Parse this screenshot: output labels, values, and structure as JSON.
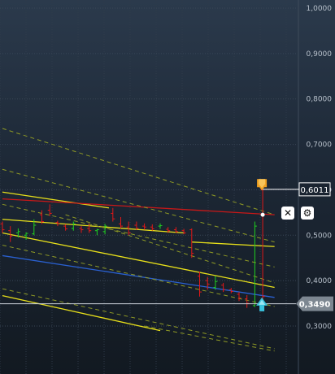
{
  "chart_data": {
    "type": "candlestick",
    "y_axis": {
      "ticks": [
        "1,0000",
        "0,9000",
        "0,8000",
        "0,7000",
        "0,6000",
        "0,5000",
        "0,4000",
        "0,3000"
      ],
      "ylim": [
        0.24,
        1.01
      ]
    },
    "price_tags": {
      "upper": "0,6011",
      "lower": "0,3490"
    },
    "colors": {
      "up": "#1fd01f",
      "down": "#e01818",
      "neutral": "#e6e62a",
      "solid_yellow": "#e8e01a",
      "dashed_yellow": "#8f9a25",
      "red_line": "#c81818",
      "blue_line": "#2a60d0",
      "arrow_orange": "#f0a020",
      "arrow_cyan": "#39c3de"
    },
    "candles": [
      {
        "o": 0.525,
        "h": 0.53,
        "l": 0.505,
        "c": 0.512
      },
      {
        "o": 0.51,
        "h": 0.52,
        "l": 0.485,
        "c": 0.498
      },
      {
        "o": 0.505,
        "h": 0.515,
        "l": 0.495,
        "c": 0.508
      },
      {
        "o": 0.5,
        "h": 0.506,
        "l": 0.49,
        "c": 0.504
      },
      {
        "o": 0.503,
        "h": 0.535,
        "l": 0.5,
        "c": 0.522
      },
      {
        "o": 0.545,
        "h": 0.555,
        "l": 0.525,
        "c": 0.53
      },
      {
        "o": 0.555,
        "h": 0.568,
        "l": 0.542,
        "c": 0.548
      },
      {
        "o": 0.528,
        "h": 0.532,
        "l": 0.52,
        "c": 0.526
      },
      {
        "o": 0.52,
        "h": 0.524,
        "l": 0.51,
        "c": 0.514
      },
      {
        "o": 0.515,
        "h": 0.53,
        "l": 0.51,
        "c": 0.525
      },
      {
        "o": 0.515,
        "h": 0.52,
        "l": 0.505,
        "c": 0.512
      },
      {
        "o": 0.515,
        "h": 0.525,
        "l": 0.505,
        "c": 0.51
      },
      {
        "o": 0.51,
        "h": 0.514,
        "l": 0.5,
        "c": 0.512
      },
      {
        "o": 0.508,
        "h": 0.525,
        "l": 0.502,
        "c": 0.52
      },
      {
        "o": 0.548,
        "h": 0.56,
        "l": 0.53,
        "c": 0.536
      },
      {
        "o": 0.525,
        "h": 0.54,
        "l": 0.515,
        "c": 0.52
      },
      {
        "o": 0.518,
        "h": 0.53,
        "l": 0.5,
        "c": 0.505
      },
      {
        "o": 0.522,
        "h": 0.53,
        "l": 0.512,
        "c": 0.515
      },
      {
        "o": 0.52,
        "h": 0.526,
        "l": 0.512,
        "c": 0.518
      },
      {
        "o": 0.518,
        "h": 0.524,
        "l": 0.51,
        "c": 0.514
      },
      {
        "o": 0.52,
        "h": 0.526,
        "l": 0.514,
        "c": 0.521
      },
      {
        "o": 0.513,
        "h": 0.518,
        "l": 0.505,
        "c": 0.51
      },
      {
        "o": 0.512,
        "h": 0.518,
        "l": 0.505,
        "c": 0.508
      },
      {
        "o": 0.51,
        "h": 0.514,
        "l": 0.502,
        "c": 0.505
      },
      {
        "o": 0.512,
        "h": 0.515,
        "l": 0.45,
        "c": 0.46
      },
      {
        "o": 0.41,
        "h": 0.42,
        "l": 0.365,
        "c": 0.375
      },
      {
        "o": 0.4,
        "h": 0.408,
        "l": 0.38,
        "c": 0.392
      },
      {
        "o": 0.385,
        "h": 0.41,
        "l": 0.38,
        "c": 0.398
      },
      {
        "o": 0.39,
        "h": 0.395,
        "l": 0.375,
        "c": 0.38
      },
      {
        "o": 0.38,
        "h": 0.384,
        "l": 0.372,
        "c": 0.376
      },
      {
        "o": 0.37,
        "h": 0.375,
        "l": 0.355,
        "c": 0.362
      },
      {
        "o": 0.36,
        "h": 0.368,
        "l": 0.34,
        "c": 0.35
      },
      {
        "o": 0.345,
        "h": 0.53,
        "l": 0.342,
        "c": 0.52
      },
      {
        "o": 0.6,
        "h": 0.601,
        "l": 0.35,
        "c": 0.365
      }
    ],
    "lines": [
      {
        "style": "solid",
        "color": "solid_yellow",
        "points": [
          [
            0,
            0.535
          ],
          [
            23,
            0.505
          ]
        ]
      },
      {
        "style": "solid",
        "color": "solid_yellow",
        "points": [
          [
            0,
            0.595
          ],
          [
            13.5,
            0.56
          ]
        ]
      },
      {
        "style": "solid",
        "color": "solid_yellow",
        "points": [
          [
            0,
            0.505
          ],
          [
            34.5,
            0.385
          ]
        ]
      },
      {
        "style": "solid",
        "color": "solid_yellow",
        "points": [
          [
            0,
            0.367
          ],
          [
            20,
            0.29
          ]
        ]
      },
      {
        "style": "solid",
        "color": "solid_yellow",
        "points": [
          [
            24,
            0.485
          ],
          [
            34.5,
            0.475
          ]
        ]
      },
      {
        "style": "solid",
        "color": "red_line",
        "points": [
          [
            0,
            0.58
          ],
          [
            34.5,
            0.545
          ]
        ]
      },
      {
        "style": "solid",
        "color": "blue_line",
        "points": [
          [
            0,
            0.455
          ],
          [
            34.5,
            0.363
          ]
        ]
      },
      {
        "style": "dashed",
        "color": "dashed_yellow",
        "points": [
          [
            0,
            0.735
          ],
          [
            34.5,
            0.545
          ]
        ]
      },
      {
        "style": "dashed",
        "color": "dashed_yellow",
        "points": [
          [
            0,
            0.645
          ],
          [
            34.5,
            0.485
          ]
        ]
      },
      {
        "style": "dashed",
        "color": "dashed_yellow",
        "points": [
          [
            0,
            0.568
          ],
          [
            34.5,
            0.43
          ]
        ]
      },
      {
        "style": "dashed",
        "color": "dashed_yellow",
        "points": [
          [
            0,
            0.478
          ],
          [
            34.5,
            0.343
          ]
        ]
      },
      {
        "style": "dashed",
        "color": "dashed_yellow",
        "points": [
          [
            0,
            0.382
          ],
          [
            34.5,
            0.25
          ]
        ]
      },
      {
        "style": "dashed",
        "color": "dashed_yellow",
        "points": [
          [
            8,
            0.545
          ],
          [
            34.5,
            0.395
          ]
        ]
      },
      {
        "style": "dashed",
        "color": "dashed_yellow",
        "points": [
          [
            18,
            0.3
          ],
          [
            34.5,
            0.245
          ]
        ]
      }
    ]
  },
  "controls": {
    "close_glyph": "✕",
    "settings_glyph": "⚙",
    "close_icon": "close-icon",
    "settings_icon": "gear-icon"
  }
}
